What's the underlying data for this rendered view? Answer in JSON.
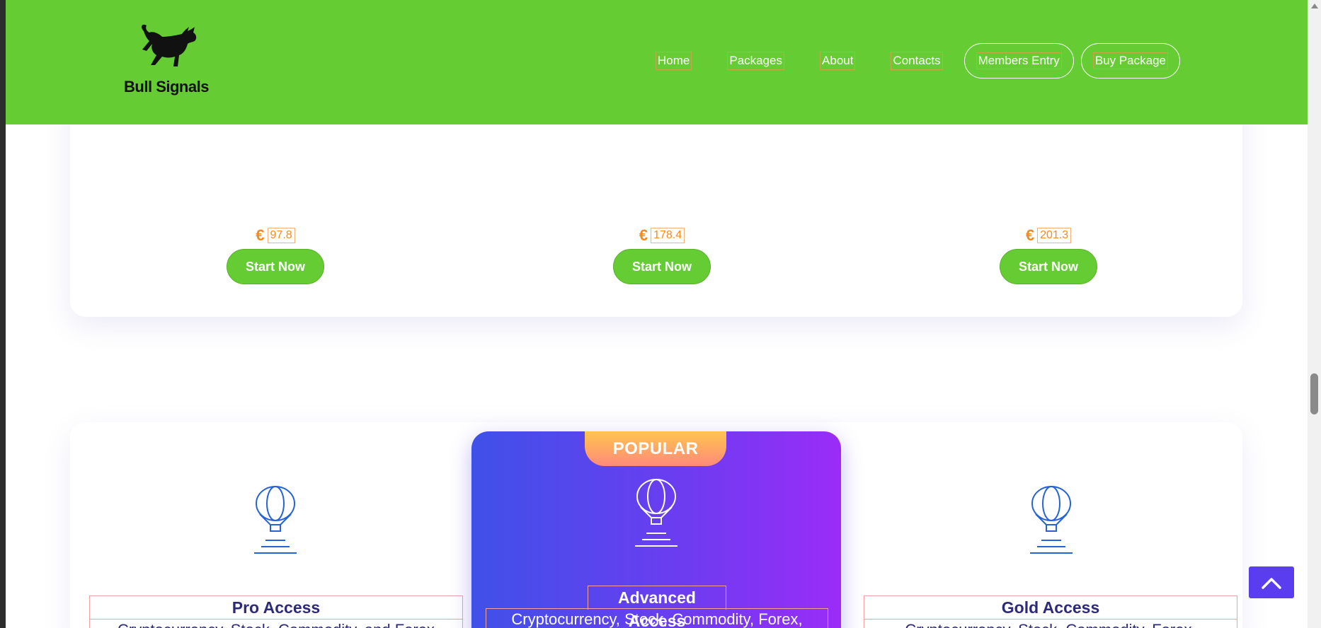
{
  "header": {
    "brand": "Bull Signals",
    "nav": {
      "home": "Home",
      "packages": "Packages",
      "about": "About",
      "contacts": "Contacts",
      "members_entry": "Members Entry",
      "buy_package": "Buy Package"
    }
  },
  "top_prices": [
    {
      "currency": "€",
      "amount": "97.8",
      "button": "Start Now"
    },
    {
      "currency": "€",
      "amount": "178.4",
      "button": "Start Now"
    },
    {
      "currency": "€",
      "amount": "201.3",
      "button": "Start Now"
    }
  ],
  "plans": [
    {
      "name": "Pro Access",
      "desc": "Cryptocurrency, Stock, Commodity, and Forex"
    },
    {
      "badge": "POPULAR",
      "name": "Advanced Access",
      "desc": "Cryptocurrency, Stock, Commodity, Forex,"
    },
    {
      "name": "Gold Access",
      "desc": "Cryptocurrency, Stock, Commodity, Forex,"
    }
  ],
  "colors": {
    "header_bg": "#66cc33",
    "button_bg": "#66cc33",
    "price_color": "#f58a1f",
    "plan_title": "#2d2a7a",
    "popular_gradient_start": "#3f51e8",
    "popular_gradient_end": "#9b2cf7",
    "badge_gradient_start": "#ffc54d",
    "badge_gradient_end": "#ff8a7a",
    "back_to_top_bg": "#5b3df0"
  },
  "icons": {
    "logo": "bull-icon",
    "plan": "hot-air-balloon-icon",
    "back_to_top": "chevron-up-icon"
  }
}
